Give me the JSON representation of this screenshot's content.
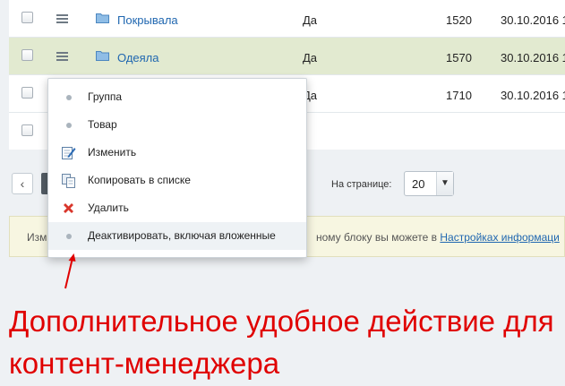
{
  "rows": [
    {
      "name": "Покрывала",
      "active": "Да",
      "sort": "1520",
      "date": "30.10.2016 1"
    },
    {
      "name": "Одеяла",
      "active": "Да",
      "sort": "1570",
      "date": "30.10.2016 1"
    },
    {
      "name": "",
      "active": "Да",
      "sort": "1710",
      "date": "30.10.2016 1"
    }
  ],
  "context_menu": {
    "items": [
      {
        "label": "Группа",
        "icon": "bullet-icon"
      },
      {
        "label": "Товар",
        "icon": "bullet-icon"
      },
      {
        "label": "Изменить",
        "icon": "edit-icon"
      },
      {
        "label": "Копировать в списке",
        "icon": "copy-icon"
      },
      {
        "label": "Удалить",
        "icon": "delete-icon"
      },
      {
        "label": "Деактивировать, включая вложенные",
        "icon": "bullet-icon"
      }
    ]
  },
  "pager": {
    "per_page_label": "На странице:",
    "per_page_value": "20",
    "prev_symbol": "‹"
  },
  "notice": {
    "text_left": "Изм",
    "text_right": "ному блоку вы можете в ",
    "link": "Настройках информаци"
  },
  "annotation": {
    "text": "Дополнительное удобное действие для контент-менеджера",
    "color": "#e00000"
  },
  "colors": {
    "link": "#2067b0",
    "highlight_row": "#e2ead0",
    "notice_bg": "#f7f6e1"
  }
}
